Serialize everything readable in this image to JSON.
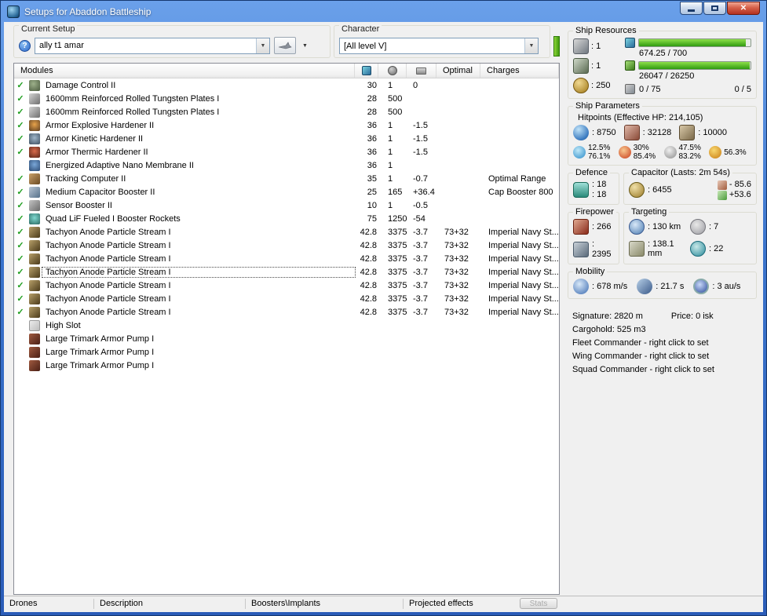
{
  "window": {
    "title": "Setups for Abaddon Battleship"
  },
  "toolbar": {
    "current_setup_label": "Current Setup",
    "setup_value": "ally t1 amar",
    "character_label": "Character",
    "character_value": "[All level V]"
  },
  "modules_table": {
    "headers": {
      "modules": "Modules",
      "optimal": "Optimal",
      "charges": "Charges"
    },
    "rows": [
      {
        "checked": true,
        "selected": false,
        "icon": "damage-control",
        "name": "Damage Control II",
        "cpu": "30",
        "pg": "1",
        "cap": "0",
        "optimal": "",
        "charges": ""
      },
      {
        "checked": true,
        "selected": false,
        "icon": "armor-plate",
        "name": "1600mm Reinforced Rolled Tungsten Plates I",
        "cpu": "28",
        "pg": "500",
        "cap": "",
        "optimal": "",
        "charges": ""
      },
      {
        "checked": true,
        "selected": false,
        "icon": "armor-plate",
        "name": "1600mm Reinforced Rolled Tungsten Plates I",
        "cpu": "28",
        "pg": "500",
        "cap": "",
        "optimal": "",
        "charges": ""
      },
      {
        "checked": true,
        "selected": false,
        "icon": "hardener-explosive",
        "name": "Armor Explosive Hardener II",
        "cpu": "36",
        "pg": "1",
        "cap": "-1.5",
        "optimal": "",
        "charges": ""
      },
      {
        "checked": true,
        "selected": false,
        "icon": "hardener-kinetic",
        "name": "Armor Kinetic Hardener II",
        "cpu": "36",
        "pg": "1",
        "cap": "-1.5",
        "optimal": "",
        "charges": ""
      },
      {
        "checked": true,
        "selected": false,
        "icon": "hardener-thermic",
        "name": "Armor Thermic Hardener II",
        "cpu": "36",
        "pg": "1",
        "cap": "-1.5",
        "optimal": "",
        "charges": ""
      },
      {
        "checked": false,
        "selected": false,
        "icon": "nano-membrane",
        "name": "Energized Adaptive Nano Membrane II",
        "cpu": "36",
        "pg": "1",
        "cap": "",
        "optimal": "",
        "charges": ""
      },
      {
        "checked": true,
        "selected": false,
        "icon": "tracking-computer",
        "name": "Tracking Computer II",
        "cpu": "35",
        "pg": "1",
        "cap": "-0.7",
        "optimal": "",
        "charges": "Optimal Range"
      },
      {
        "checked": true,
        "selected": false,
        "icon": "cap-booster",
        "name": "Medium Capacitor Booster II",
        "cpu": "25",
        "pg": "165",
        "cap": "+36.4",
        "optimal": "",
        "charges": "Cap Booster 800"
      },
      {
        "checked": true,
        "selected": false,
        "icon": "sensor-booster",
        "name": "Sensor Booster II",
        "cpu": "10",
        "pg": "1",
        "cap": "-0.5",
        "optimal": "",
        "charges": ""
      },
      {
        "checked": true,
        "selected": false,
        "icon": "booster-rockets",
        "name": "Quad LiF Fueled I Booster Rockets",
        "cpu": "75",
        "pg": "1250",
        "cap": "-54",
        "optimal": "",
        "charges": ""
      },
      {
        "checked": true,
        "selected": false,
        "icon": "tachyon-laser",
        "name": "Tachyon Anode Particle Stream I",
        "cpu": "42.8",
        "pg": "3375",
        "cap": "-3.7",
        "optimal": "73+32",
        "charges": "Imperial Navy St..."
      },
      {
        "checked": true,
        "selected": false,
        "icon": "tachyon-laser",
        "name": "Tachyon Anode Particle Stream I",
        "cpu": "42.8",
        "pg": "3375",
        "cap": "-3.7",
        "optimal": "73+32",
        "charges": "Imperial Navy St..."
      },
      {
        "checked": true,
        "selected": false,
        "icon": "tachyon-laser",
        "name": "Tachyon Anode Particle Stream I",
        "cpu": "42.8",
        "pg": "3375",
        "cap": "-3.7",
        "optimal": "73+32",
        "charges": "Imperial Navy St..."
      },
      {
        "checked": true,
        "selected": true,
        "icon": "tachyon-laser",
        "name": "Tachyon Anode Particle Stream I",
        "cpu": "42.8",
        "pg": "3375",
        "cap": "-3.7",
        "optimal": "73+32",
        "charges": "Imperial Navy St..."
      },
      {
        "checked": true,
        "selected": false,
        "icon": "tachyon-laser",
        "name": "Tachyon Anode Particle Stream I",
        "cpu": "42.8",
        "pg": "3375",
        "cap": "-3.7",
        "optimal": "73+32",
        "charges": "Imperial Navy St..."
      },
      {
        "checked": true,
        "selected": false,
        "icon": "tachyon-laser",
        "name": "Tachyon Anode Particle Stream I",
        "cpu": "42.8",
        "pg": "3375",
        "cap": "-3.7",
        "optimal": "73+32",
        "charges": "Imperial Navy St..."
      },
      {
        "checked": true,
        "selected": false,
        "icon": "tachyon-laser",
        "name": "Tachyon Anode Particle Stream I",
        "cpu": "42.8",
        "pg": "3375",
        "cap": "-3.7",
        "optimal": "73+32",
        "charges": "Imperial Navy St..."
      },
      {
        "checked": false,
        "selected": false,
        "icon": "empty-high-slot",
        "name": "High Slot",
        "cpu": "",
        "pg": "",
        "cap": "",
        "optimal": "",
        "charges": ""
      },
      {
        "checked": false,
        "selected": false,
        "icon": "trimark-rig",
        "name": "Large Trimark Armor Pump I",
        "cpu": "",
        "pg": "",
        "cap": "",
        "optimal": "",
        "charges": ""
      },
      {
        "checked": false,
        "selected": false,
        "icon": "trimark-rig",
        "name": "Large Trimark Armor Pump I",
        "cpu": "",
        "pg": "",
        "cap": "",
        "optimal": "",
        "charges": ""
      },
      {
        "checked": false,
        "selected": false,
        "icon": "trimark-rig",
        "name": "Large Trimark Armor Pump I",
        "cpu": "",
        "pg": "",
        "cap": "",
        "optimal": "",
        "charges": ""
      }
    ]
  },
  "ship_resources": {
    "label": "Ship Resources",
    "turret_value": ": 1",
    "launcher_value": ": 1",
    "calibration_value": ": 250",
    "cpu_usage": "674.25 / 700",
    "cpu_pct": 96,
    "powergrid_usage": "26047 / 26250",
    "powergrid_pct": 99,
    "upgrade_usage": "0 / 75",
    "rig_usage": "0 / 5"
  },
  "ship_parameters": {
    "label": "Ship Parameters",
    "hitpoints_label": "Hitpoints (Effective HP: 214,105)",
    "shield_hp": ": 8750",
    "armor_hp": ": 32128",
    "structure_hp": ": 10000",
    "resists": [
      {
        "top": "12.5%",
        "bottom": "76.1%"
      },
      {
        "top": "30%",
        "bottom": "85.4%"
      },
      {
        "top": "47.5%",
        "bottom": "83.2%"
      },
      {
        "top": "56.3%",
        "bottom": ""
      }
    ]
  },
  "defence": {
    "label": "Defence",
    "value_top": ": 18",
    "value_bottom": ": 18"
  },
  "capacitor": {
    "label": "Capacitor (Lasts: 2m 54s)",
    "amount": ": 6455",
    "drain": "- 85.6",
    "recharge": "+53.6"
  },
  "firepower": {
    "label": "Firepower",
    "dps": ": 266",
    "volley": ": 2395"
  },
  "targeting": {
    "label": "Targeting",
    "range": ": 130 km",
    "max_targets": ": 7",
    "scan_resolution": ": 138.1 mm",
    "sensor_strength": ": 22"
  },
  "mobility": {
    "label": "Mobility",
    "speed": ": 678 m/s",
    "align_time": ": 21.7 s",
    "warp_speed": ": 3 au/s"
  },
  "summary": {
    "signature": "Signature: 2820 m",
    "price": "Price: 0 isk",
    "cargohold": "Cargohold: 525 m3",
    "fleet_commander": "Fleet Commander - right click to set",
    "wing_commander": "Wing Commander - right click to set",
    "squad_commander": "Squad Commander - right click to set"
  },
  "bottom_bar": {
    "tabs": [
      "Drones",
      "Description",
      "Boosters\\Implants",
      "Projected effects"
    ],
    "stats_button": "Stats"
  }
}
